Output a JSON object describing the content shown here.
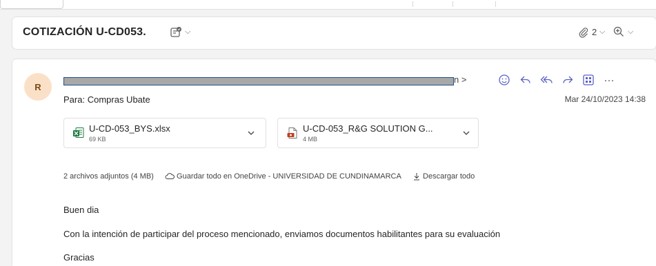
{
  "subject": {
    "title": "COTIZACIÓN U-CD053.",
    "attachment_count": "2"
  },
  "message": {
    "avatar_initial": "R",
    "sender_suffix": "n >",
    "to_label": "Para:",
    "to_name": "Compras Ubate",
    "date": "Mar 24/10/2023 14:38",
    "actions": [
      "emoji-icon",
      "reply-icon",
      "reply-all-icon",
      "forward-icon",
      "apps-icon",
      "more-icon"
    ]
  },
  "attachments": [
    {
      "name": "U-CD-053_BYS.xlsx",
      "size": "69 KB",
      "type": "excel-file-icon"
    },
    {
      "name": "U-CD-053_R&G SOLUTION G...",
      "size": "4 MB",
      "type": "pdf-file-icon"
    }
  ],
  "attachment_summary": {
    "count_text": "2 archivos adjuntos (4 MB)",
    "save_label": "Guardar todo en OneDrive - UNIVERSIDAD DE CUNDINAMARCA",
    "download_label": "Descargar todo"
  },
  "body": {
    "greeting": "Buen dia",
    "line1": "Con la intención de participar del proceso mencionado, enviamos documentos habilitantes para su evaluación",
    "closing": "Gracias"
  },
  "colors": {
    "accent": "#5b5fc7",
    "avatar_bg": "#fbe0c8",
    "excel_green": "#1f7a3f",
    "pdf_red": "#c43e1c"
  }
}
